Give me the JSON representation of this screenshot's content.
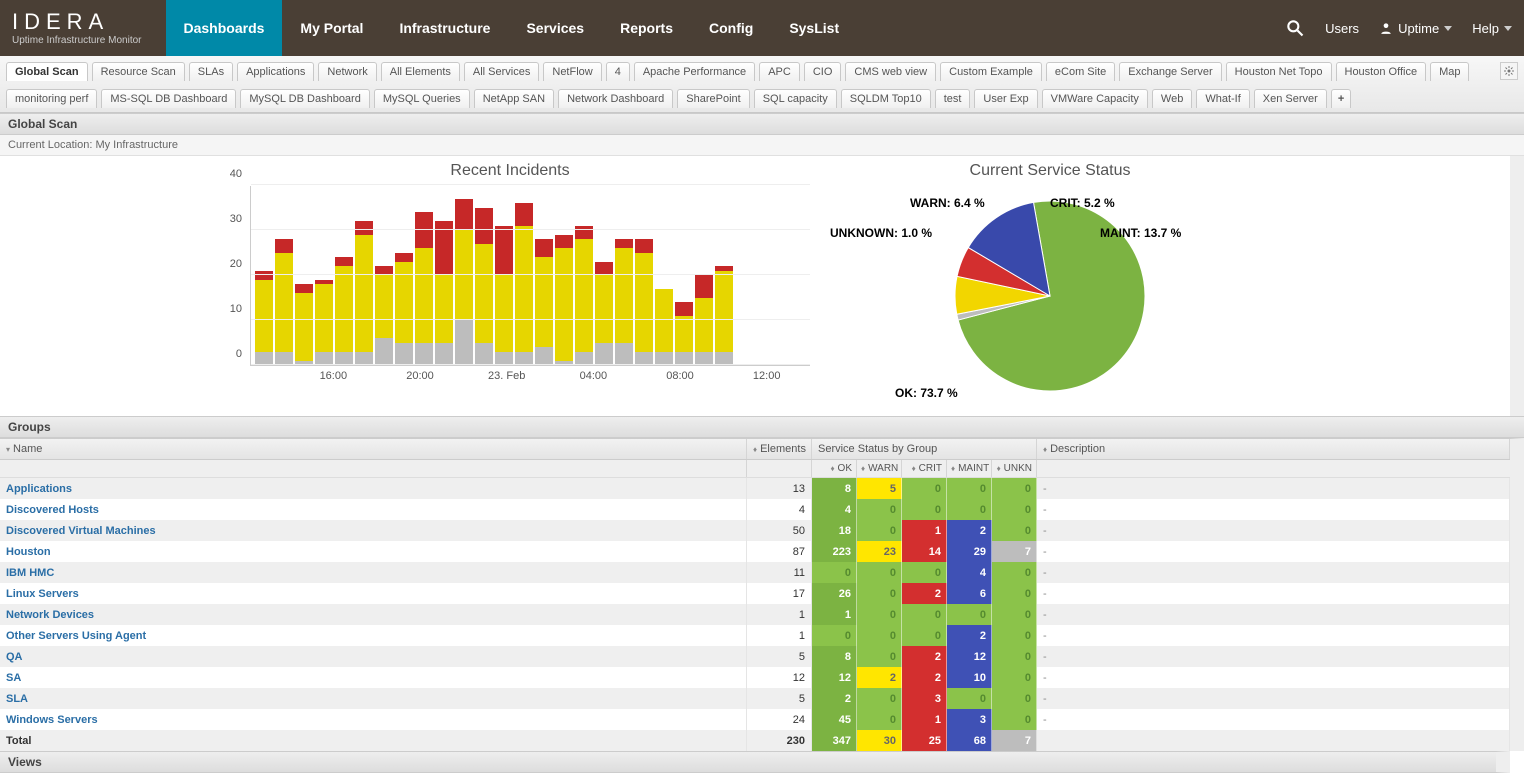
{
  "brand": {
    "name": "IDERA",
    "product": "Uptime Infrastructure Monitor"
  },
  "topnav": {
    "items": [
      "Dashboards",
      "My Portal",
      "Infrastructure",
      "Services",
      "Reports",
      "Config",
      "SysList"
    ],
    "active": "Dashboards"
  },
  "userbar": {
    "users": "Users",
    "account": "Uptime",
    "help": "Help"
  },
  "subtabs": {
    "items": [
      "Global Scan",
      "Resource Scan",
      "SLAs",
      "Applications",
      "Network",
      "All Elements",
      "All Services",
      "NetFlow",
      "4",
      "Apache Performance",
      "APC",
      "CIO",
      "CMS web view",
      "Custom Example",
      "eCom Site",
      "Exchange Server",
      "Houston Net Topo",
      "Houston Office",
      "Map",
      "monitoring perf",
      "MS-SQL DB Dashboard",
      "MySQL DB Dashboard",
      "MySQL Queries",
      "NetApp SAN",
      "Network Dashboard",
      "SharePoint",
      "SQL capacity",
      "SQLDM Top10",
      "test",
      "User Exp",
      "VMWare Capacity",
      "Web",
      "What-If",
      "Xen Server"
    ],
    "active": "Global Scan",
    "add": "+"
  },
  "page": {
    "title": "Global Scan",
    "location_label": "Current Location:",
    "location_value": "My Infrastructure"
  },
  "chart_data": [
    {
      "type": "bar",
      "title": "Recent Incidents",
      "xticks": [
        "16:00",
        "20:00",
        "23. Feb",
        "04:00",
        "08:00",
        "12:00"
      ],
      "yticks": [
        0,
        10,
        20,
        30,
        40
      ],
      "ymax": 40,
      "series_names": [
        "gray",
        "yellow",
        "red"
      ],
      "colors": {
        "gray": "#bdbdbd",
        "yellow": "#e6d600",
        "red": "#c62828"
      },
      "stacks": [
        {
          "gray": 3,
          "yellow": 16,
          "red": 2
        },
        {
          "gray": 3,
          "yellow": 22,
          "red": 3
        },
        {
          "gray": 1,
          "yellow": 15,
          "red": 2
        },
        {
          "gray": 3,
          "yellow": 15,
          "red": 1
        },
        {
          "gray": 3,
          "yellow": 19,
          "red": 2
        },
        {
          "gray": 3,
          "yellow": 26,
          "red": 3
        },
        {
          "gray": 6,
          "yellow": 14,
          "red": 2
        },
        {
          "gray": 5,
          "yellow": 18,
          "red": 2
        },
        {
          "gray": 5,
          "yellow": 21,
          "red": 8
        },
        {
          "gray": 5,
          "yellow": 15,
          "red": 12
        },
        {
          "gray": 10,
          "yellow": 20,
          "red": 7
        },
        {
          "gray": 5,
          "yellow": 22,
          "red": 8
        },
        {
          "gray": 3,
          "yellow": 17,
          "red": 11
        },
        {
          "gray": 3,
          "yellow": 28,
          "red": 5
        },
        {
          "gray": 4,
          "yellow": 20,
          "red": 4
        },
        {
          "gray": 1,
          "yellow": 25,
          "red": 3
        },
        {
          "gray": 3,
          "yellow": 25,
          "red": 3
        },
        {
          "gray": 5,
          "yellow": 15,
          "red": 3
        },
        {
          "gray": 5,
          "yellow": 21,
          "red": 2
        },
        {
          "gray": 3,
          "yellow": 22,
          "red": 3
        },
        {
          "gray": 3,
          "yellow": 14,
          "red": 0
        },
        {
          "gray": 3,
          "yellow": 8,
          "red": 3
        },
        {
          "gray": 3,
          "yellow": 12,
          "red": 5
        },
        {
          "gray": 3,
          "yellow": 18,
          "red": 1
        }
      ]
    },
    {
      "type": "pie",
      "title": "Current Service Status",
      "slices": [
        {
          "label": "OK",
          "pct": 73.7,
          "color": "#7cb342"
        },
        {
          "label": "UNKNOWN",
          "pct": 1.0,
          "color": "#bdbdbd"
        },
        {
          "label": "WARN",
          "pct": 6.4,
          "color": "#f2d600"
        },
        {
          "label": "CRIT",
          "pct": 5.2,
          "color": "#d32f2f"
        },
        {
          "label": "MAINT",
          "pct": 13.7,
          "color": "#3949ab"
        }
      ]
    }
  ],
  "groups": {
    "panel_title": "Groups",
    "columns": {
      "name": "Name",
      "elements": "Elements",
      "status_group": "Service Status by Group",
      "description": "Description",
      "ok": "OK",
      "warn": "WARN",
      "crit": "CRIT",
      "maint": "MAINT",
      "unkn": "UNKN"
    },
    "rows": [
      {
        "name": "Applications",
        "elements": 13,
        "ok": 8,
        "warn": 5,
        "crit": 0,
        "maint": 0,
        "unkn": 0,
        "desc": "-"
      },
      {
        "name": "Discovered Hosts",
        "elements": 4,
        "ok": 4,
        "warn": 0,
        "crit": 0,
        "maint": 0,
        "unkn": 0,
        "desc": "-"
      },
      {
        "name": "Discovered Virtual Machines",
        "elements": 50,
        "ok": 18,
        "warn": 0,
        "crit": 1,
        "maint": 2,
        "unkn": 0,
        "desc": "-"
      },
      {
        "name": "Houston",
        "elements": 87,
        "ok": 223,
        "warn": 23,
        "crit": 14,
        "maint": 29,
        "unkn": 7,
        "desc": "-"
      },
      {
        "name": "IBM HMC",
        "elements": 11,
        "ok": 0,
        "warn": 0,
        "crit": 0,
        "maint": 4,
        "unkn": 0,
        "desc": "-"
      },
      {
        "name": "Linux Servers",
        "elements": 17,
        "ok": 26,
        "warn": 0,
        "crit": 2,
        "maint": 6,
        "unkn": 0,
        "desc": "-"
      },
      {
        "name": "Network Devices",
        "elements": 1,
        "ok": 1,
        "warn": 0,
        "crit": 0,
        "maint": 0,
        "unkn": 0,
        "desc": "-"
      },
      {
        "name": "Other Servers Using Agent",
        "elements": 1,
        "ok": 0,
        "warn": 0,
        "crit": 0,
        "maint": 2,
        "unkn": 0,
        "desc": "-"
      },
      {
        "name": "QA",
        "elements": 5,
        "ok": 8,
        "warn": 0,
        "crit": 2,
        "maint": 12,
        "unkn": 0,
        "desc": "-"
      },
      {
        "name": "SA",
        "elements": 12,
        "ok": 12,
        "warn": 2,
        "crit": 2,
        "maint": 10,
        "unkn": 0,
        "desc": "-"
      },
      {
        "name": "SLA",
        "elements": 5,
        "ok": 2,
        "warn": 0,
        "crit": 3,
        "maint": 0,
        "unkn": 0,
        "desc": "-"
      },
      {
        "name": "Windows Servers",
        "elements": 24,
        "ok": 45,
        "warn": 0,
        "crit": 1,
        "maint": 3,
        "unkn": 0,
        "desc": "-"
      }
    ],
    "total": {
      "label": "Total",
      "elements": 230,
      "ok": 347,
      "warn": 30,
      "crit": 25,
      "maint": 68,
      "unkn": 7
    }
  },
  "views": {
    "panel_title": "Views"
  },
  "layout": {
    "col_name_w": 747,
    "col_elem_w": 65,
    "col_status_w": 225,
    "col_desc_w": 450,
    "status_cell_w": 45
  }
}
